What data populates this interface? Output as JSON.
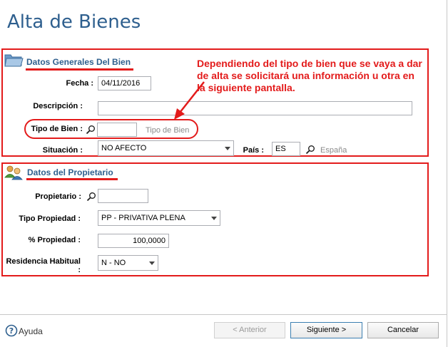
{
  "page": {
    "title": "Alta de Bienes"
  },
  "general": {
    "title": "Datos Generales Del Bien",
    "fecha_label": "Fecha :",
    "fecha_value": "04/11/2016",
    "descripcion_label": "Descripción :",
    "descripcion_value": "",
    "tipo_label": "Tipo de Bien :",
    "tipo_value": "",
    "tipo_placeholder": "Tipo de Bien",
    "situacion_label": "Situación :",
    "situacion_value": "NO AFECTO",
    "pais_label": "País :",
    "pais_code": "ES",
    "pais_name": "España"
  },
  "annotation": {
    "text": "Dependiendo del tipo de bien que se vaya a dar de alta se solicitará una información u otra en la siguiente pantalla.",
    "color": "#e31b1b"
  },
  "owner": {
    "title": "Datos del Propietario",
    "propietario_label": "Propietario :",
    "propietario_value": "",
    "tipo_propiedad_label": "Tipo Propiedad :",
    "tipo_propiedad_value": "PP - PRIVATIVA PLENA",
    "porcentaje_label": "% Propiedad :",
    "porcentaje_value": "100,0000",
    "residencia_label": "Residencia Habitual :",
    "residencia_value": "N - NO"
  },
  "footer": {
    "help_label": "Ayuda",
    "back_label": "<  Anterior",
    "next_label": "Siguiente  >",
    "cancel_label": "Cancelar"
  },
  "colors": {
    "accent": "#2e5f8e",
    "highlight": "#e31b1b"
  }
}
